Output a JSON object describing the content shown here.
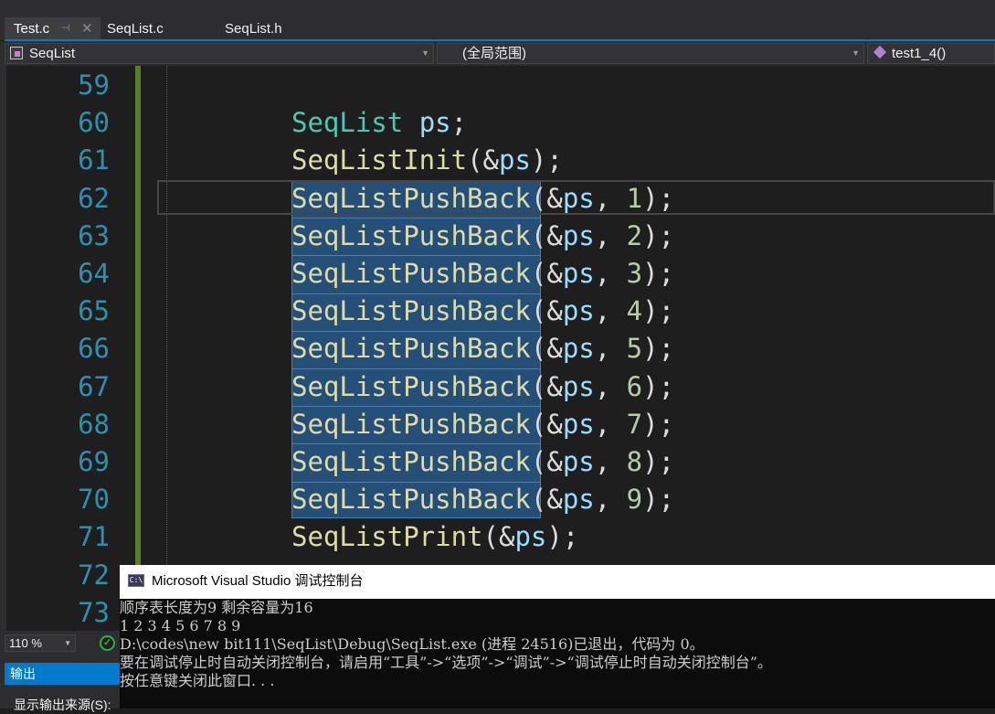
{
  "tabs": [
    {
      "label": "Test.c",
      "active": true
    },
    {
      "label": "SeqList.c",
      "active": false
    },
    {
      "label": "SeqList.h",
      "active": false
    }
  ],
  "tab_icons": {
    "pin": "⊣",
    "close": "✕"
  },
  "navbar": {
    "project": "SeqList",
    "scope": "(全局范围)",
    "function": "test1_4()"
  },
  "editor": {
    "line_numbers": [
      "59",
      "60",
      "61",
      "62",
      "63",
      "64",
      "65",
      "66",
      "67",
      "68",
      "69",
      "70",
      "71",
      "72",
      "73"
    ],
    "code_lines": [
      {
        "tokens": []
      },
      {
        "tokens": [
          {
            "t": "SeqList",
            "c": "type"
          },
          {
            "t": " ",
            "c": "punc"
          },
          {
            "t": "ps",
            "c": "var"
          },
          {
            "t": ";",
            "c": "punc"
          }
        ]
      },
      {
        "tokens": [
          {
            "t": "SeqListInit",
            "c": "fn"
          },
          {
            "t": "(&",
            "c": "punc"
          },
          {
            "t": "ps",
            "c": "var"
          },
          {
            "t": ");",
            "c": "punc"
          }
        ]
      },
      {
        "tokens": [
          {
            "t": "SeqListPushBack",
            "c": "fn"
          },
          {
            "t": "(&",
            "c": "punc"
          },
          {
            "t": "ps",
            "c": "var"
          },
          {
            "t": ", ",
            "c": "punc"
          },
          {
            "t": "1",
            "c": "num"
          },
          {
            "t": ");",
            "c": "punc"
          }
        ]
      },
      {
        "tokens": [
          {
            "t": "SeqListPushBack",
            "c": "fn"
          },
          {
            "t": "(&",
            "c": "punc"
          },
          {
            "t": "ps",
            "c": "var"
          },
          {
            "t": ", ",
            "c": "punc"
          },
          {
            "t": "2",
            "c": "num"
          },
          {
            "t": ");",
            "c": "punc"
          }
        ]
      },
      {
        "tokens": [
          {
            "t": "SeqListPushBack",
            "c": "fn"
          },
          {
            "t": "(&",
            "c": "punc"
          },
          {
            "t": "ps",
            "c": "var"
          },
          {
            "t": ", ",
            "c": "punc"
          },
          {
            "t": "3",
            "c": "num"
          },
          {
            "t": ");",
            "c": "punc"
          }
        ]
      },
      {
        "tokens": [
          {
            "t": "SeqListPushBack",
            "c": "fn"
          },
          {
            "t": "(&",
            "c": "punc"
          },
          {
            "t": "ps",
            "c": "var"
          },
          {
            "t": ", ",
            "c": "punc"
          },
          {
            "t": "4",
            "c": "num"
          },
          {
            "t": ");",
            "c": "punc"
          }
        ]
      },
      {
        "tokens": [
          {
            "t": "SeqListPushBack",
            "c": "fn"
          },
          {
            "t": "(&",
            "c": "punc"
          },
          {
            "t": "ps",
            "c": "var"
          },
          {
            "t": ", ",
            "c": "punc"
          },
          {
            "t": "5",
            "c": "num"
          },
          {
            "t": ");",
            "c": "punc"
          }
        ]
      },
      {
        "tokens": [
          {
            "t": "SeqListPushBack",
            "c": "fn"
          },
          {
            "t": "(&",
            "c": "punc"
          },
          {
            "t": "ps",
            "c": "var"
          },
          {
            "t": ", ",
            "c": "punc"
          },
          {
            "t": "6",
            "c": "num"
          },
          {
            "t": ");",
            "c": "punc"
          }
        ]
      },
      {
        "tokens": [
          {
            "t": "SeqListPushBack",
            "c": "fn"
          },
          {
            "t": "(&",
            "c": "punc"
          },
          {
            "t": "ps",
            "c": "var"
          },
          {
            "t": ", ",
            "c": "punc"
          },
          {
            "t": "7",
            "c": "num"
          },
          {
            "t": ");",
            "c": "punc"
          }
        ]
      },
      {
        "tokens": [
          {
            "t": "SeqListPushBack",
            "c": "fn"
          },
          {
            "t": "(&",
            "c": "punc"
          },
          {
            "t": "ps",
            "c": "var"
          },
          {
            "t": ", ",
            "c": "punc"
          },
          {
            "t": "8",
            "c": "num"
          },
          {
            "t": ");",
            "c": "punc"
          }
        ]
      },
      {
        "tokens": [
          {
            "t": "SeqListPushBack",
            "c": "fn"
          },
          {
            "t": "(&",
            "c": "punc"
          },
          {
            "t": "ps",
            "c": "var"
          },
          {
            "t": ", ",
            "c": "punc"
          },
          {
            "t": "9",
            "c": "num"
          },
          {
            "t": ");",
            "c": "punc"
          }
        ]
      },
      {
        "tokens": [
          {
            "t": "SeqListPrint",
            "c": "fn"
          },
          {
            "t": "(&",
            "c": "punc"
          },
          {
            "t": "ps",
            "c": "var"
          },
          {
            "t": ");",
            "c": "punc"
          }
        ]
      },
      {
        "tokens": []
      },
      {
        "tokens": []
      }
    ],
    "current_line": "62",
    "selection_lines": [
      "62",
      "63",
      "64",
      "65",
      "66",
      "67",
      "68",
      "69",
      "70"
    ],
    "syntax_colors": {
      "type": "#4ec9b0",
      "var": "#9cdcfe",
      "fn": "#dcdcaa",
      "num": "#b5cea8",
      "punc": "#dcdcdc",
      "line_number": "#2b91af"
    }
  },
  "zoom": {
    "value": "110 %",
    "status_icon": "check-circle-icon"
  },
  "output_panel": {
    "title": "输出",
    "source_label": "显示输出来源(S):"
  },
  "console": {
    "title": "Microsoft Visual Studio 调试控制台",
    "icon_text": "C:\\",
    "lines": [
      "顺序表长度为9 剩余容量为16",
      "1 2 3 4 5 6 7 8 9",
      "D:\\codes\\new bit111\\SeqList\\Debug\\SeqList.exe (进程 24516)已退出，代码为 0。",
      "要在调试停止时自动关闭控制台，请启用“工具”->“选项”->“调试”->“调试停止时自动关闭控制台”。",
      "按任意键关闭此窗口. . ."
    ]
  },
  "colors": {
    "accent": "#007acc",
    "editor_bg": "#1e1e1e",
    "selection": "#264f78",
    "change_bar": "#577c2a"
  }
}
